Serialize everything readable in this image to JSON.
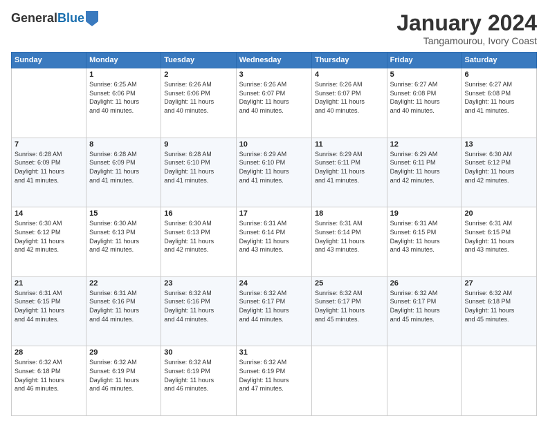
{
  "header": {
    "logo_general": "General",
    "logo_blue": "Blue",
    "month_title": "January 2024",
    "location": "Tangamourou, Ivory Coast"
  },
  "weekdays": [
    "Sunday",
    "Monday",
    "Tuesday",
    "Wednesday",
    "Thursday",
    "Friday",
    "Saturday"
  ],
  "weeks": [
    [
      {
        "day": "",
        "sunrise": "",
        "sunset": "",
        "daylight": ""
      },
      {
        "day": "1",
        "sunrise": "6:25 AM",
        "sunset": "6:06 PM",
        "daylight": "11 hours and 40 minutes."
      },
      {
        "day": "2",
        "sunrise": "6:26 AM",
        "sunset": "6:06 PM",
        "daylight": "11 hours and 40 minutes."
      },
      {
        "day": "3",
        "sunrise": "6:26 AM",
        "sunset": "6:07 PM",
        "daylight": "11 hours and 40 minutes."
      },
      {
        "day": "4",
        "sunrise": "6:26 AM",
        "sunset": "6:07 PM",
        "daylight": "11 hours and 40 minutes."
      },
      {
        "day": "5",
        "sunrise": "6:27 AM",
        "sunset": "6:08 PM",
        "daylight": "11 hours and 40 minutes."
      },
      {
        "day": "6",
        "sunrise": "6:27 AM",
        "sunset": "6:08 PM",
        "daylight": "11 hours and 41 minutes."
      }
    ],
    [
      {
        "day": "7",
        "sunrise": "6:28 AM",
        "sunset": "6:09 PM",
        "daylight": "11 hours and 41 minutes."
      },
      {
        "day": "8",
        "sunrise": "6:28 AM",
        "sunset": "6:09 PM",
        "daylight": "11 hours and 41 minutes."
      },
      {
        "day": "9",
        "sunrise": "6:28 AM",
        "sunset": "6:10 PM",
        "daylight": "11 hours and 41 minutes."
      },
      {
        "day": "10",
        "sunrise": "6:29 AM",
        "sunset": "6:10 PM",
        "daylight": "11 hours and 41 minutes."
      },
      {
        "day": "11",
        "sunrise": "6:29 AM",
        "sunset": "6:11 PM",
        "daylight": "11 hours and 41 minutes."
      },
      {
        "day": "12",
        "sunrise": "6:29 AM",
        "sunset": "6:11 PM",
        "daylight": "11 hours and 42 minutes."
      },
      {
        "day": "13",
        "sunrise": "6:30 AM",
        "sunset": "6:12 PM",
        "daylight": "11 hours and 42 minutes."
      }
    ],
    [
      {
        "day": "14",
        "sunrise": "6:30 AM",
        "sunset": "6:12 PM",
        "daylight": "11 hours and 42 minutes."
      },
      {
        "day": "15",
        "sunrise": "6:30 AM",
        "sunset": "6:13 PM",
        "daylight": "11 hours and 42 minutes."
      },
      {
        "day": "16",
        "sunrise": "6:30 AM",
        "sunset": "6:13 PM",
        "daylight": "11 hours and 42 minutes."
      },
      {
        "day": "17",
        "sunrise": "6:31 AM",
        "sunset": "6:14 PM",
        "daylight": "11 hours and 43 minutes."
      },
      {
        "day": "18",
        "sunrise": "6:31 AM",
        "sunset": "6:14 PM",
        "daylight": "11 hours and 43 minutes."
      },
      {
        "day": "19",
        "sunrise": "6:31 AM",
        "sunset": "6:15 PM",
        "daylight": "11 hours and 43 minutes."
      },
      {
        "day": "20",
        "sunrise": "6:31 AM",
        "sunset": "6:15 PM",
        "daylight": "11 hours and 43 minutes."
      }
    ],
    [
      {
        "day": "21",
        "sunrise": "6:31 AM",
        "sunset": "6:15 PM",
        "daylight": "11 hours and 44 minutes."
      },
      {
        "day": "22",
        "sunrise": "6:31 AM",
        "sunset": "6:16 PM",
        "daylight": "11 hours and 44 minutes."
      },
      {
        "day": "23",
        "sunrise": "6:32 AM",
        "sunset": "6:16 PM",
        "daylight": "11 hours and 44 minutes."
      },
      {
        "day": "24",
        "sunrise": "6:32 AM",
        "sunset": "6:17 PM",
        "daylight": "11 hours and 44 minutes."
      },
      {
        "day": "25",
        "sunrise": "6:32 AM",
        "sunset": "6:17 PM",
        "daylight": "11 hours and 45 minutes."
      },
      {
        "day": "26",
        "sunrise": "6:32 AM",
        "sunset": "6:17 PM",
        "daylight": "11 hours and 45 minutes."
      },
      {
        "day": "27",
        "sunrise": "6:32 AM",
        "sunset": "6:18 PM",
        "daylight": "11 hours and 45 minutes."
      }
    ],
    [
      {
        "day": "28",
        "sunrise": "6:32 AM",
        "sunset": "6:18 PM",
        "daylight": "11 hours and 46 minutes."
      },
      {
        "day": "29",
        "sunrise": "6:32 AM",
        "sunset": "6:19 PM",
        "daylight": "11 hours and 46 minutes."
      },
      {
        "day": "30",
        "sunrise": "6:32 AM",
        "sunset": "6:19 PM",
        "daylight": "11 hours and 46 minutes."
      },
      {
        "day": "31",
        "sunrise": "6:32 AM",
        "sunset": "6:19 PM",
        "daylight": "11 hours and 47 minutes."
      },
      {
        "day": "",
        "sunrise": "",
        "sunset": "",
        "daylight": ""
      },
      {
        "day": "",
        "sunrise": "",
        "sunset": "",
        "daylight": ""
      },
      {
        "day": "",
        "sunrise": "",
        "sunset": "",
        "daylight": ""
      }
    ]
  ]
}
